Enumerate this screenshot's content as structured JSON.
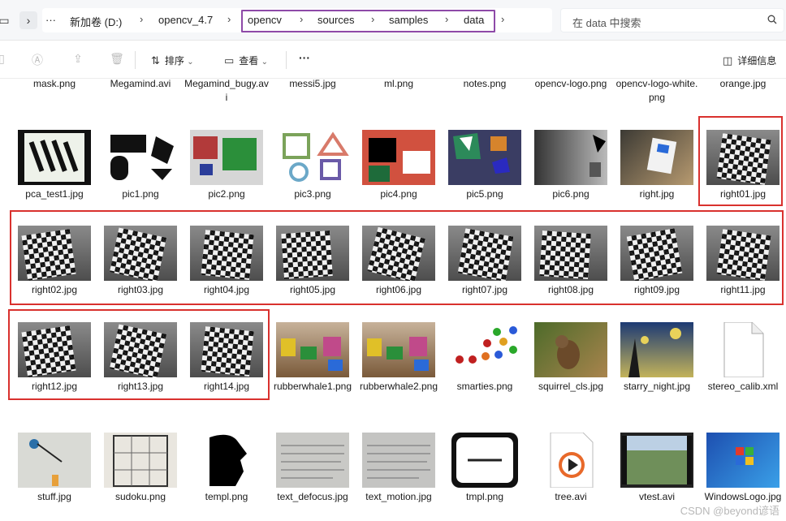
{
  "addressbar": {
    "crumbs": [
      "新加卷 (D:)",
      "opencv_4.7",
      "opencv",
      "sources",
      "samples",
      "data"
    ],
    "search_placeholder": "在 data 中搜索"
  },
  "toolbar": {
    "sort_label": "排序",
    "view_label": "查看",
    "more_label": "···",
    "details_label": "详细信息"
  },
  "files": {
    "row0": [
      "mask.png",
      "Megamind.avi",
      "Megamind_bugy.avi",
      "messi5.jpg",
      "ml.png",
      "notes.png",
      "opencv-logo.png",
      "opencv-logo-white.png",
      "orange.jpg"
    ],
    "row1": [
      "pca_test1.jpg",
      "pic1.png",
      "pic2.png",
      "pic3.png",
      "pic4.png",
      "pic5.png",
      "pic6.png",
      "right.jpg",
      "right01.jpg"
    ],
    "row2": [
      "right02.jpg",
      "right03.jpg",
      "right04.jpg",
      "right05.jpg",
      "right06.jpg",
      "right07.jpg",
      "right08.jpg",
      "right09.jpg",
      "right11.jpg"
    ],
    "row3": [
      "right12.jpg",
      "right13.jpg",
      "right14.jpg",
      "rubberwhale1.png",
      "rubberwhale2.png",
      "smarties.png",
      "squirrel_cls.jpg",
      "starry_night.jpg",
      "stereo_calib.xml"
    ],
    "row4": [
      "stuff.jpg",
      "sudoku.png",
      "templ.png",
      "text_defocus.jpg",
      "text_motion.jpg",
      "tmpl.png",
      "tree.avi",
      "vtest.avi",
      "WindowsLogo.jpg"
    ]
  },
  "watermark": "CSDN @beyond谚语",
  "colors": {
    "crumb_highlight": "#8e4aa8",
    "selection_box": "#d9312e"
  }
}
